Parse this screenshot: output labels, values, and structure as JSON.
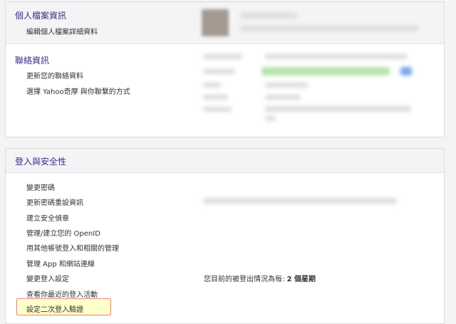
{
  "profile": {
    "title": "個人檔案資訊",
    "edit_link": "編輯個人檔案詳細資料"
  },
  "contact": {
    "title": "聯絡資訊",
    "links": [
      "更新您的聯絡資料",
      "選擇 Yahoo奇摩 與你聯繫的方式"
    ]
  },
  "security": {
    "title": "登入與安全性",
    "links": [
      "變更密碼",
      "更新密碼重設資訊",
      "建立安全偵章",
      "管理/建立您的 OpenID",
      "用其他帳號登入和相關的管理",
      "管理 App 和網站連線",
      "變更登入設定",
      "查看你最近的登入活動",
      "設定二次登入驗證"
    ],
    "signout_status_prefix": "您目前的被登出情況為每: ",
    "signout_status_value": "2 個星期"
  },
  "colors": {
    "section_title": "#3f2a8a",
    "highlight_fill": "#ffffc8",
    "highlight_border": "#e8808a"
  }
}
